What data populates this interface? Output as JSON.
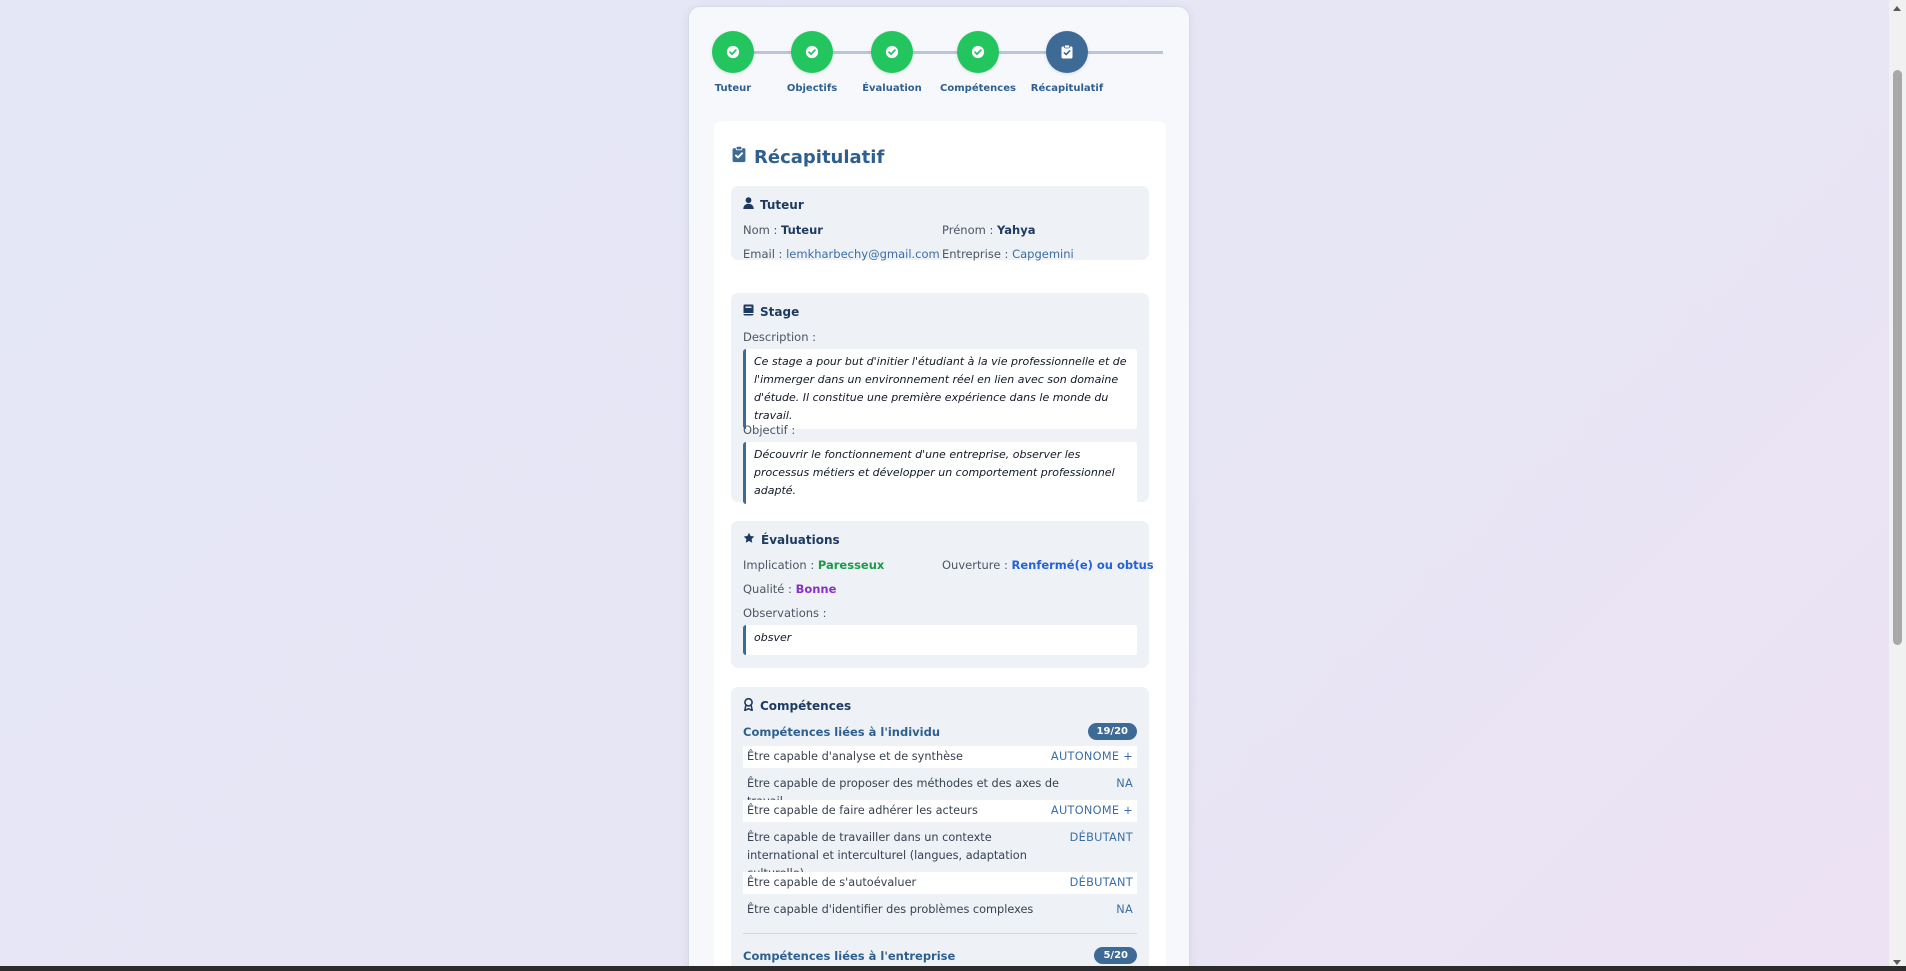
{
  "stepper": {
    "steps": [
      {
        "label": "Tuteur",
        "state": "done"
      },
      {
        "label": "Objectifs",
        "state": "done"
      },
      {
        "label": "Évaluation",
        "state": "done"
      },
      {
        "label": "Compétences",
        "state": "done"
      },
      {
        "label": "Récapitulatif",
        "state": "active"
      }
    ]
  },
  "recap": {
    "title": "Récapitulatif",
    "tuteur": {
      "heading": "Tuteur",
      "nom_label": "Nom :",
      "nom": "Tuteur",
      "prenom_label": "Prénom :",
      "prenom": "Yahya",
      "email_label": "Email :",
      "email": "lemkharbechy@gmail.com",
      "entreprise_label": "Entreprise :",
      "entreprise": "Capgemini"
    },
    "stage": {
      "heading": "Stage",
      "description_label": "Description :",
      "description": "Ce stage a pour but d'initier l'étudiant à la vie professionnelle et de l'immerger dans un environnement réel en lien avec son domaine d'étude. Il constitue une première expérience dans le monde du travail.",
      "objectif_label": "Objectif :",
      "objectif": "Découvrir le fonctionnement d'une entreprise, observer les processus métiers et développer un comportement professionnel adapté."
    },
    "evaluations": {
      "heading": "Évaluations",
      "implication_label": "Implication :",
      "implication": "Paresseux",
      "ouverture_label": "Ouverture :",
      "ouverture": "Renfermé(e) ou obtus",
      "qualite_label": "Qualité :",
      "qualite": "Bonne",
      "observations_label": "Observations :",
      "observations": "obsver"
    },
    "competences": {
      "heading": "Compétences",
      "groups": [
        {
          "title": "Compétences liées à l'individu",
          "score": "19/20",
          "items": [
            {
              "name": "Être capable d'analyse et de synthèse",
              "level": "AUTONOME +"
            },
            {
              "name": "Être capable de proposer des méthodes et des axes de travail",
              "level": "NA"
            },
            {
              "name": "Être capable de faire adhérer les acteurs",
              "level": "AUTONOME +"
            },
            {
              "name": "Être capable de travailler dans un contexte international et interculturel (langues, adaptation culturelle)",
              "level": "DÉBUTANT"
            },
            {
              "name": "Être capable de s'autoévaluer",
              "level": "DÉBUTANT"
            },
            {
              "name": "Être capable d'identifier des problèmes complexes",
              "level": "NA"
            }
          ]
        },
        {
          "title": "Compétences liées à l'entreprise",
          "score": "5/20"
        }
      ]
    }
  },
  "colors": {
    "done": "#22c55e",
    "active": "#3d6b96",
    "primary_text": "#2f5f8f"
  }
}
